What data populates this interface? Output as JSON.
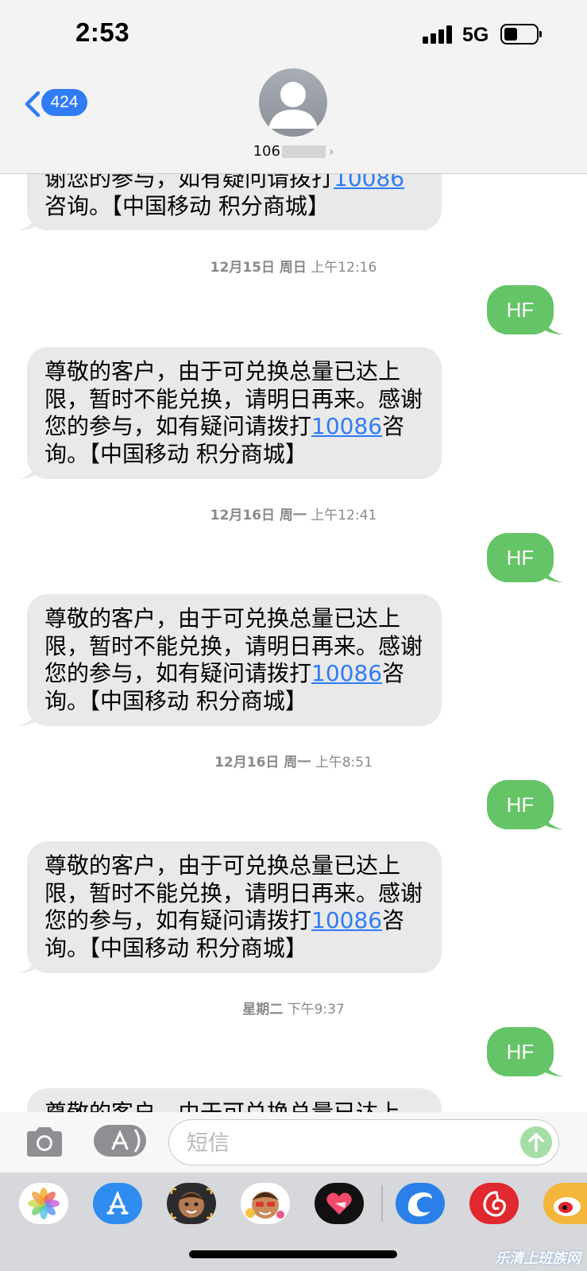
{
  "status_bar": {
    "time": "2:53",
    "network": "5G"
  },
  "header": {
    "back_count": "424",
    "contact_visible": "106",
    "contact_arrow": "›"
  },
  "messages": {
    "reply_text": "HF",
    "incoming_text_before_link": "尊敬的客户，由于可兑换总量已达上限，暂时不能兑换，请明日再来。感谢您的参与，如有疑问请拨打",
    "incoming_link": "10086",
    "incoming_text_after_link": "咨询。【中国移动 积分商城】",
    "top_partial_line1": "谢您的参与，如有疑问请拨打",
    "top_partial_line2": "咨询。【中国移动 积分商城】",
    "bottom_partial": "尊敬的客户，由于可兑换总量已达上",
    "timestamps": [
      {
        "date": "12月15日 周日",
        "time": "上午12:16"
      },
      {
        "date": "12月16日 周一",
        "time": "上午12:41"
      },
      {
        "date": "12月16日 周一",
        "time": "上午8:51"
      },
      {
        "date": "星期二",
        "time": "下午9:37"
      }
    ]
  },
  "input": {
    "placeholder": "短信"
  },
  "drawer": {
    "apps": [
      "photos-app",
      "app-store-app",
      "memoji-app",
      "animoji-app",
      "digital-touch-app",
      "search-app",
      "music-app",
      "weibo-app"
    ]
  },
  "watermark": "乐清上班族网"
}
